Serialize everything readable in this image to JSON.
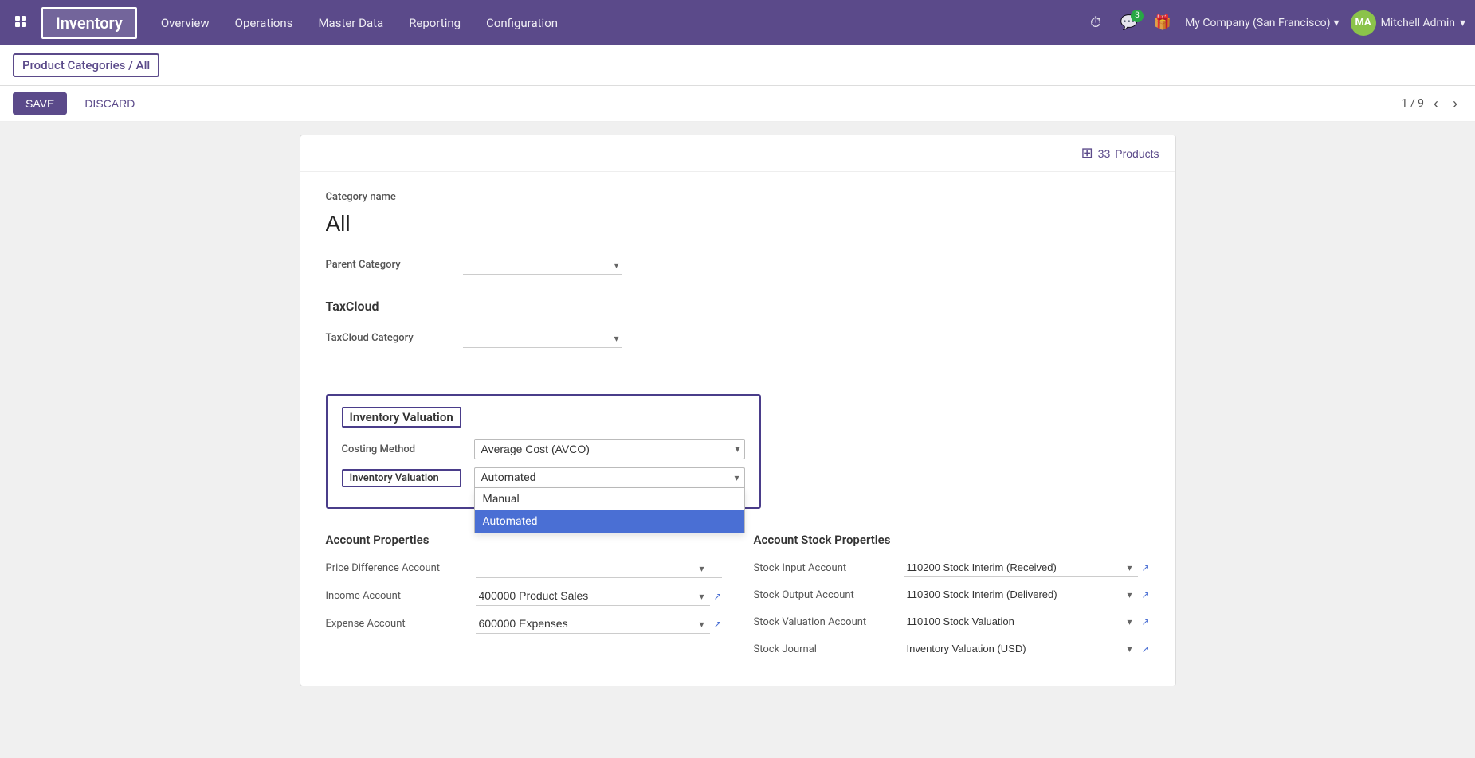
{
  "topnav": {
    "title": "Inventory",
    "menu_items": [
      "Overview",
      "Operations",
      "Master Data",
      "Reporting",
      "Configuration"
    ],
    "badge_count": "3",
    "company": "My Company (San Francisco)",
    "user": "Mitchell Admin",
    "user_initials": "MA"
  },
  "breadcrumb": {
    "path": "Product Categories / All"
  },
  "actions": {
    "save_label": "SAVE",
    "discard_label": "DISCARD",
    "pagination": "1 / 9"
  },
  "form": {
    "products_count": "33",
    "products_label": "Products",
    "category_name_label": "Category name",
    "category_name_value": "All",
    "parent_category_label": "Parent Category",
    "parent_category_placeholder": "",
    "taxcloud_section": "TaxCloud",
    "taxcloud_category_label": "TaxCloud Category",
    "inventory_valuation_section": "Inventory Valuation",
    "costing_method_label": "Costing Method",
    "costing_method_value": "Average Cost (AVCO)",
    "inventory_valuation_label": "Inventory Valuation",
    "inventory_valuation_value": "Automated",
    "dropdown_options": [
      "Manual",
      "Automated"
    ],
    "account_properties_title": "Account Properties",
    "price_diff_label": "Price Difference Account",
    "income_account_label": "Income Account",
    "income_account_value": "400000 Product Sales",
    "expense_account_label": "Expense Account",
    "expense_account_value": "600000 Expenses",
    "stock_properties_title": "Account Stock Properties",
    "stock_input_label": "Stock Input Account",
    "stock_input_value": "110200 Stock Interim (Received)",
    "stock_output_label": "Stock Output Account",
    "stock_output_value": "110300 Stock Interim (Delivered)",
    "stock_valuation_label": "Stock Valuation Account",
    "stock_valuation_value": "110100 Stock Valuation",
    "stock_journal_label": "Stock Journal",
    "stock_journal_value": "Inventory Valuation (USD)"
  }
}
